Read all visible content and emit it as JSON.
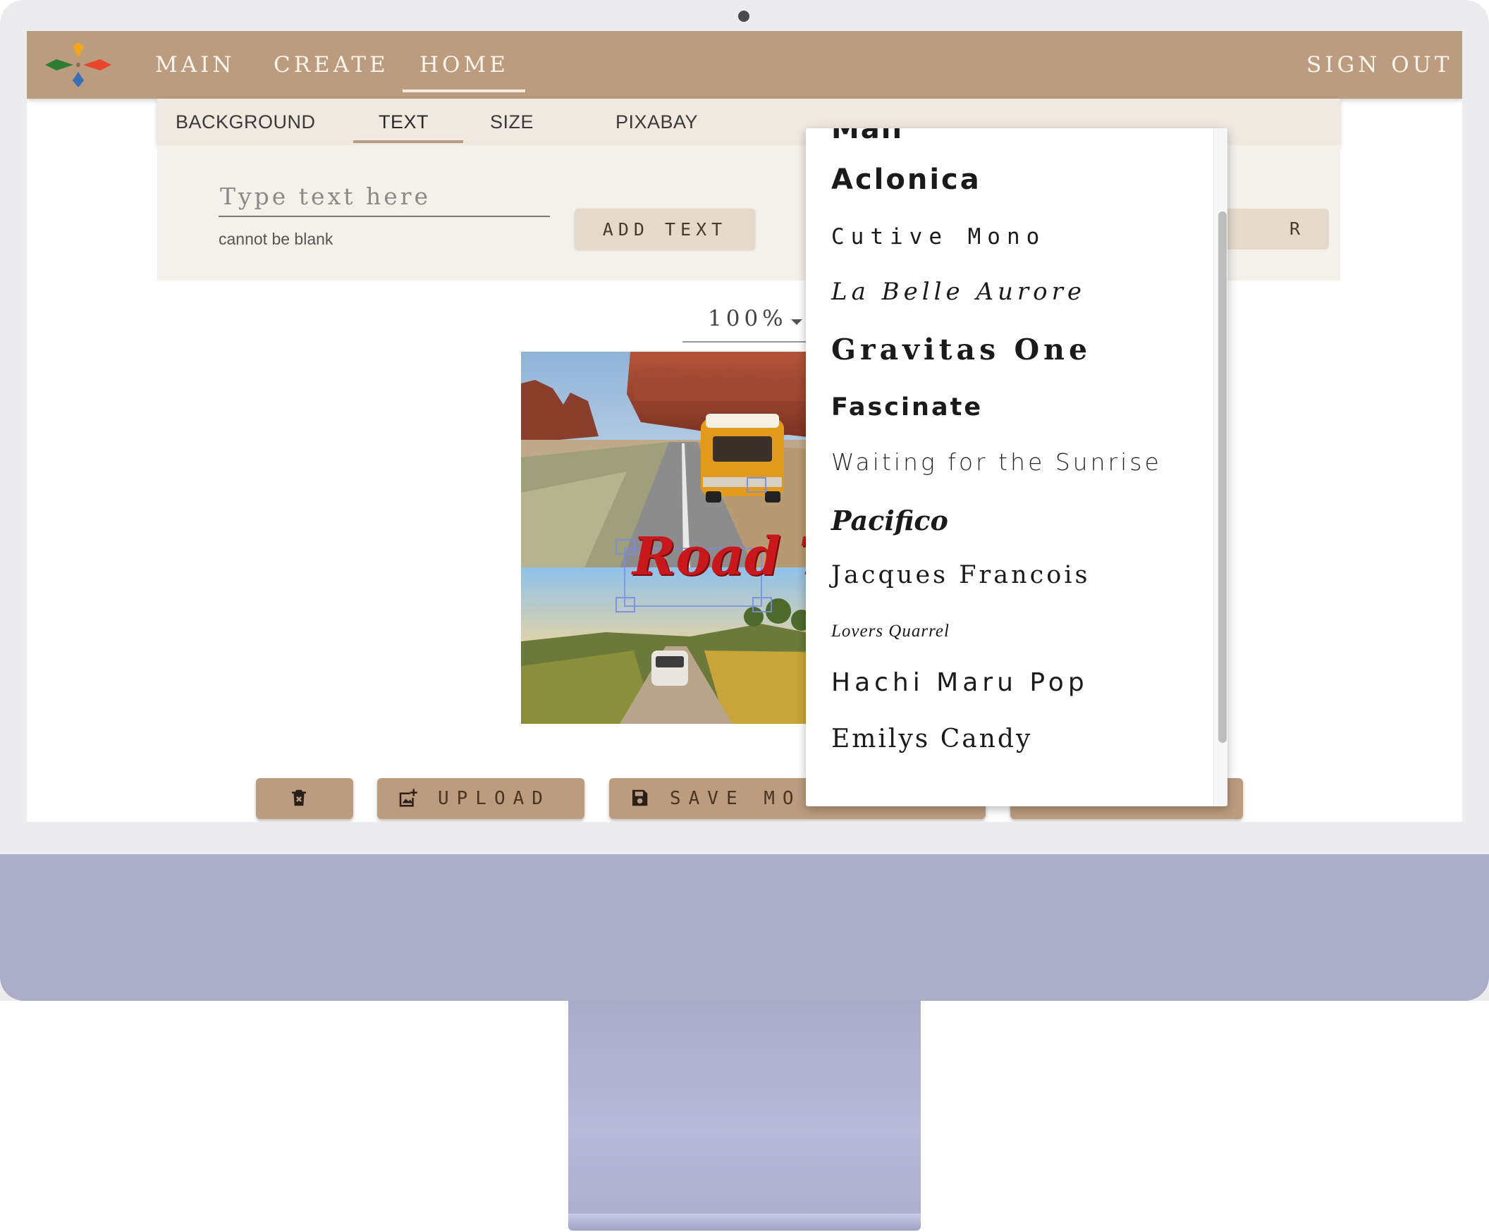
{
  "nav": {
    "items": [
      "MAIN",
      "CREATE",
      "HOME"
    ],
    "active": "HOME",
    "sign_out": "SIGN OUT"
  },
  "tabs": {
    "items": [
      "BACKGROUND",
      "TEXT",
      "SIZE",
      "PIXABAY"
    ],
    "active": "TEXT"
  },
  "text_panel": {
    "input_placeholder": "Type text here",
    "input_value": "",
    "helper_text": "cannot be blank",
    "add_text_label": "ADD TEXT",
    "partially_hidden_button_label": "R"
  },
  "zoom": {
    "value": "100%"
  },
  "canvas": {
    "overlay_text": "Road T"
  },
  "actions": {
    "delete_icon": "delete-icon",
    "upload_label": "UPLOAD",
    "save_label": "SAVE MO"
  },
  "font_dropdown": {
    "partial_top_item": "Mali",
    "items": [
      "Aclonica",
      "Cutive Mono",
      "La Belle Aurore",
      "Gravitas One",
      "Fascinate",
      "Waiting for the Sunrise",
      "Pacifico",
      "Jacques Francois",
      "Lovers Quarrel",
      "Hachi Maru Pop",
      "Emilys Candy"
    ]
  },
  "colors": {
    "appbar": "#bb9c7f",
    "tab_bar": "#efe9e0",
    "panel": "#f4f0ea",
    "button": "#bb9c7f",
    "overlay_text": "#c8181c",
    "monitor_chin": "#abadc9"
  }
}
